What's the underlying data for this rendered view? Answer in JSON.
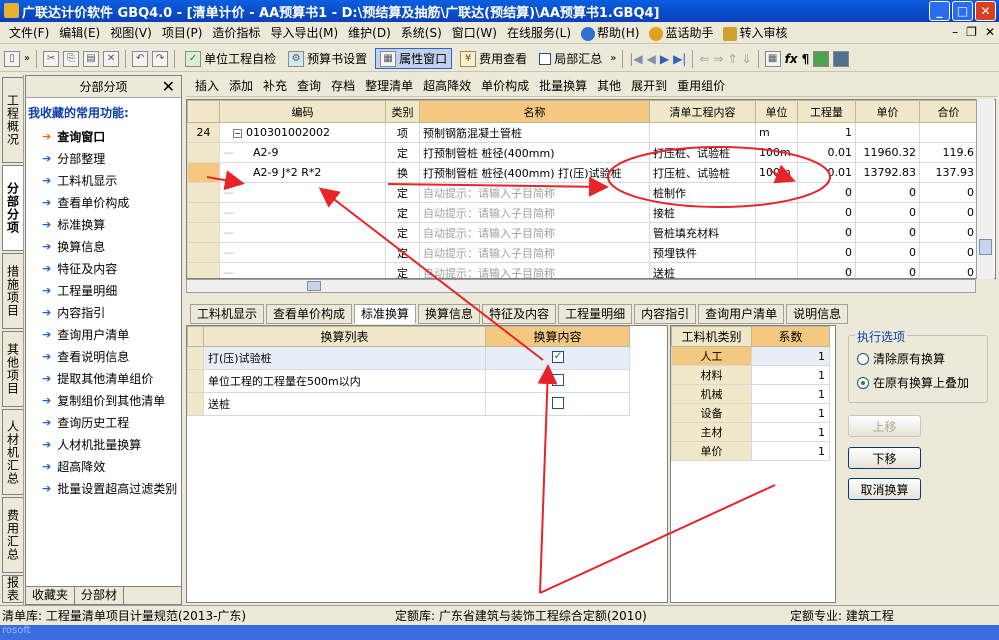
{
  "window": {
    "title": "广联达计价软件 GBQ4.0 - [清单计价 - AA预算书1 - D:\\预结算及抽筋\\广联达(预结算)\\AA预算书1.GBQ4]"
  },
  "menu": [
    "文件(F)",
    "编辑(E)",
    "视图(V)",
    "项目(P)",
    "造价指标",
    "导入导出(M)",
    "维护(D)",
    "系统(S)",
    "窗口(W)",
    "在线服务(L)",
    "帮助(H)",
    "蓝话助手",
    "转入审核"
  ],
  "toolbar1": {
    "unit_check": "单位工程自检",
    "budget_setting": "预算书设置",
    "property_window": "属性窗口",
    "fee_view": "费用查看",
    "local_summary": "局部汇总"
  },
  "left_tabs": [
    "工程概况",
    "分部分项",
    "措施项目",
    "其他项目",
    "人材机汇总",
    "费用汇总",
    "报表"
  ],
  "left_panel": {
    "header": "分部分项",
    "favorites_title": "我收藏的常用功能:",
    "items": [
      "查询窗口",
      "分部整理",
      "工料机显示",
      "查看单价构成",
      "标准换算",
      "换算信息",
      "特征及内容",
      "工程量明细",
      "内容指引",
      "查询用户清单",
      "查看说明信息",
      "提取其他清单组价",
      "复制组价到其他清单",
      "查询历史工程",
      "人材机批量换算",
      "超高降效",
      "批量设置超高过滤类别"
    ],
    "bottom_tabs": [
      "收藏夹",
      "分部材"
    ]
  },
  "toolbar2": [
    "插入",
    "添加",
    "补充",
    "查询",
    "存档",
    "整理清单",
    "超高降效",
    "单价构成",
    "批量换算",
    "其他",
    "展开到",
    "重用组价"
  ],
  "grid": {
    "headers": [
      "编码",
      "类别",
      "名称",
      "清单工程内容",
      "单位",
      "工程量",
      "单价",
      "合价"
    ],
    "rows": [
      {
        "rn": "24",
        "code": "010301002002",
        "type": "项",
        "name": "预制钢筋混凝土管桩",
        "content": "",
        "unit": "m",
        "qty": "1",
        "price": "",
        "total": ""
      },
      {
        "rn": "",
        "code": "A2-9",
        "type": "定",
        "name": "打预制管桩 桩径(400mm)",
        "content": "打压桩、试验桩",
        "unit": "100m",
        "qty": "0.01",
        "price": "11960.32",
        "total": "119.6"
      },
      {
        "rn": "",
        "code": "A2-9 J*2 R*2",
        "type": "换",
        "name": "打预制管桩 桩径(400mm) 打(压)试验桩",
        "content": "打压桩、试验桩",
        "unit": "100m",
        "qty": "0.01",
        "price": "13792.83",
        "total": "137.93"
      },
      {
        "rn": "",
        "code": "",
        "type": "定",
        "name": "自动提示：请输入子目简称",
        "content": "桩制作",
        "unit": "",
        "qty": "0",
        "price": "0",
        "total": "0"
      },
      {
        "rn": "",
        "code": "",
        "type": "定",
        "name": "自动提示：请输入子目简称",
        "content": "接桩",
        "unit": "",
        "qty": "0",
        "price": "0",
        "total": "0"
      },
      {
        "rn": "",
        "code": "",
        "type": "定",
        "name": "自动提示：请输入子目简称",
        "content": "管桩填充材料",
        "unit": "",
        "qty": "0",
        "price": "0",
        "total": "0"
      },
      {
        "rn": "",
        "code": "",
        "type": "定",
        "name": "自动提示：请输入子目简称",
        "content": "预埋铁件",
        "unit": "",
        "qty": "0",
        "price": "0",
        "total": "0"
      },
      {
        "rn": "",
        "code": "",
        "type": "定",
        "name": "自动提示：请输入子目简称",
        "content": "送桩",
        "unit": "",
        "qty": "0",
        "price": "0",
        "total": "0"
      }
    ]
  },
  "bottom_tabs": [
    "工料机显示",
    "查看单价构成",
    "标准换算",
    "换算信息",
    "特征及内容",
    "工程量明细",
    "内容指引",
    "查询用户清单",
    "说明信息"
  ],
  "conversion": {
    "headers": [
      "换算列表",
      "换算内容"
    ],
    "rows": [
      {
        "label": "打(压)试验桩",
        "checked": true
      },
      {
        "label": "单位工程的工程量在500m以内",
        "checked": false
      },
      {
        "label": "送桩",
        "checked": false
      }
    ]
  },
  "coef": {
    "headers": [
      "工料机类别",
      "系数"
    ],
    "rows": [
      {
        "label": "人工",
        "value": "1"
      },
      {
        "label": "材料",
        "value": "1"
      },
      {
        "label": "机械",
        "value": "1"
      },
      {
        "label": "设备",
        "value": "1"
      },
      {
        "label": "主材",
        "value": "1"
      },
      {
        "label": "单价",
        "value": "1"
      }
    ]
  },
  "options": {
    "legend": "执行选项",
    "opt1": "清除原有换算",
    "opt2": "在原有换算上叠加",
    "selected": "opt2",
    "up": "上移",
    "down": "下移",
    "cancel": "取消换算"
  },
  "status": {
    "list_lib": "清单库:  工程量清单项目计量规范(2013-广东)",
    "quota_lib": "定额库:  广东省建筑与装饰工程综合定额(2010)",
    "quota_spec": "定额专业:  建筑工程"
  },
  "taskbar": {
    "text": "rosoft"
  },
  "colors": {
    "annotation": "#e8232a",
    "title_blue": "#0a5fe0",
    "header_orange": "#f4c880"
  }
}
